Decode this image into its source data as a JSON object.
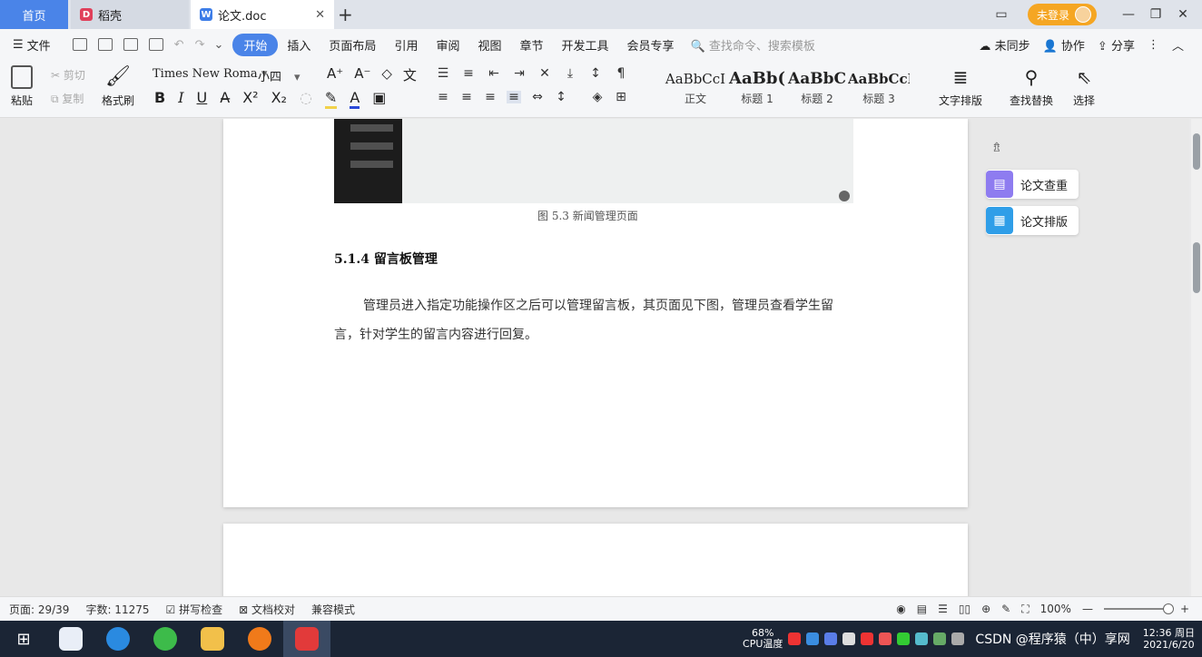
{
  "titlebar": {
    "tabs": [
      {
        "label": "首页"
      },
      {
        "label": "稻壳"
      },
      {
        "label": "论文.doc"
      }
    ],
    "login_label": "未登录"
  },
  "menu": {
    "file": "文件",
    "items": [
      "开始",
      "插入",
      "页面布局",
      "引用",
      "审阅",
      "视图",
      "章节",
      "开发工具",
      "会员专享"
    ],
    "search_cmd": "查找命令、搜索模板",
    "sync": "未同步",
    "collab": "协作",
    "share": "分享"
  },
  "ribbon": {
    "paste": "粘贴",
    "cut": "剪切",
    "copy": "复制",
    "format_painter": "格式刷",
    "font_name": "Times New Roma",
    "font_size": "小四",
    "styles": [
      {
        "sample": "AaBbCcI",
        "name": "正文"
      },
      {
        "sample": "AaBb(",
        "name": "标题 1"
      },
      {
        "sample": "AaBbC",
        "name": "标题 2"
      },
      {
        "sample": "AaBbCcI",
        "name": "标题 3"
      }
    ],
    "text_layout": "文字排版",
    "find_replace": "查找替换",
    "select": "选择"
  },
  "document": {
    "fig_menu": [
      "",
      "",
      ""
    ],
    "caption": "图 5.3  新闻管理页面",
    "heading": "5.1.4  留言板管理",
    "paragraph": "管理员进入指定功能操作区之后可以管理留言板，其页面见下图，管理员查看学生留言，针对学生的留言内容进行回复。"
  },
  "side_panel": {
    "check": "论文查重",
    "layout": "论文排版"
  },
  "statusbar": {
    "page": "页面: 29/39",
    "words": "字数: 11275",
    "spell": "拼写检查",
    "proof": "文档校对",
    "compat": "兼容模式",
    "zoom": "100%"
  },
  "taskbar": {
    "cpu": "68%",
    "cpu_label": "CPU温度",
    "time": "12:36 周日",
    "date": "2021/6/20",
    "watermark": "CSDN @程序猿（中）享网"
  },
  "colors": {
    "accent": "#4a84e8",
    "login": "#f5a623",
    "taskbar": "#1b2535"
  }
}
